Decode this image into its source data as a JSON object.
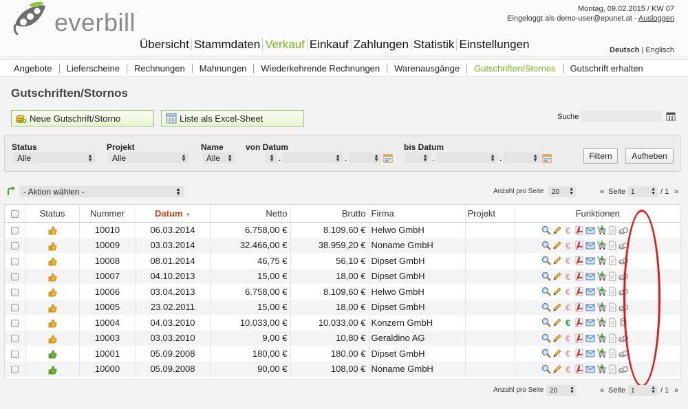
{
  "app": {
    "name": "everbill"
  },
  "user": {
    "date_line": "Montag, 09.02.2015 / KW 07",
    "login_line": "Eingeloggt als demo-user@epunet.at -",
    "logout": "Ausloggen"
  },
  "main_nav": [
    {
      "label": "Übersicht",
      "active": false
    },
    {
      "label": "Stammdaten",
      "active": false
    },
    {
      "label": "Verkauf",
      "active": true
    },
    {
      "label": "Einkauf",
      "active": false
    },
    {
      "label": "Zahlungen",
      "active": false
    },
    {
      "label": "Statistik",
      "active": false
    },
    {
      "label": "Einstellungen",
      "active": false
    }
  ],
  "lang": {
    "active": "Deutsch",
    "sep": "|",
    "other": "Englisch"
  },
  "sub_nav": [
    {
      "label": "Angebote",
      "active": false
    },
    {
      "label": "Lieferscheine",
      "active": false
    },
    {
      "label": "Rechnungen",
      "active": false
    },
    {
      "label": "Mahnungen",
      "active": false
    },
    {
      "label": "Wiederkehrende Rechnungen",
      "active": false
    },
    {
      "label": "Warenausgänge",
      "active": false
    },
    {
      "label": "Gutschriften/Stornos",
      "active": true
    },
    {
      "label": "Gutschrift erhalten",
      "active": false
    }
  ],
  "page_title": "Gutschriften/Stornos",
  "buttons": {
    "new": "Neue Gutschrift/Storno",
    "excel": "Liste als Excel-Sheet"
  },
  "search": {
    "label": "Suche",
    "value": ""
  },
  "filter": {
    "status_label": "Status",
    "status_value": "Alle",
    "projekt_label": "Projekt",
    "projekt_value": "Alle",
    "name_label": "Name",
    "name_value": "Alle",
    "from_label": "von Datum",
    "to_label": "bis Datum",
    "date_sep": ".",
    "filter_btn": "Filtern",
    "reset_btn": "Aufheben"
  },
  "actions": {
    "select_value": "- Aktion wählen -"
  },
  "pager": {
    "per_page_label": "Anzahl pro Seite",
    "per_page_value": "20",
    "prev": "«",
    "page_label": "Seite",
    "page_value": "1",
    "of": "/ 1",
    "next": "»"
  },
  "table": {
    "headers": {
      "status": "Status",
      "nummer": "Nummer",
      "datum": "Datum",
      "netto": "Netto",
      "brutto": "Brutto",
      "firma": "Firma",
      "projekt": "Projekt",
      "funktionen": "Funktionen"
    },
    "rows": [
      {
        "status": "yellow",
        "nummer": "10010",
        "datum": "06.03.2014",
        "netto": "6.758,00 €",
        "brutto": "8.109,60 €",
        "firma": "Helwo GmbH",
        "euro": "red",
        "last_icon": "coins-icon"
      },
      {
        "status": "yellow",
        "nummer": "10009",
        "datum": "03.03.2014",
        "netto": "32.466,00 €",
        "brutto": "38.959,20 €",
        "firma": "Noname GmbH",
        "euro": "red",
        "last_icon": "coins-icon"
      },
      {
        "status": "yellow",
        "nummer": "10008",
        "datum": "08.01.2014",
        "netto": "46,75 €",
        "brutto": "56,10 €",
        "firma": "Dipset GmbH",
        "euro": "red",
        "last_icon": "coins-icon"
      },
      {
        "status": "yellow",
        "nummer": "10007",
        "datum": "04.10.2013",
        "netto": "15,00 €",
        "brutto": "18,00 €",
        "firma": "Dipset GmbH",
        "euro": "red",
        "last_icon": "coins-icon"
      },
      {
        "status": "yellow",
        "nummer": "10006",
        "datum": "03.04.2013",
        "netto": "6.758,00 €",
        "brutto": "8.109,60 €",
        "firma": "Helwo GmbH",
        "euro": "red",
        "last_icon": "coins-icon"
      },
      {
        "status": "yellow",
        "nummer": "10005",
        "datum": "23.02.2011",
        "netto": "15,00 €",
        "brutto": "18,00 €",
        "firma": "Dipset GmbH",
        "euro": "red",
        "last_icon": "coins-icon"
      },
      {
        "status": "yellow",
        "nummer": "10004",
        "datum": "04.03.2010",
        "netto": "10.033,00 €",
        "brutto": "10.033,00 €",
        "firma": "Konzern GmbH",
        "euro": "green",
        "last_icon": "coin-stack-icon"
      },
      {
        "status": "yellow",
        "nummer": "10003",
        "datum": "03.03.2010",
        "netto": "9,00 €",
        "brutto": "10,80 €",
        "firma": "Geraldino AG",
        "euro": "red",
        "last_icon": "coins-icon"
      },
      {
        "status": "green",
        "nummer": "10001",
        "datum": "05.09.2008",
        "netto": "180,00 €",
        "brutto": "180,00 €",
        "firma": "Dipset GmbH",
        "euro": "red",
        "last_icon": "coins-icon"
      },
      {
        "status": "green",
        "nummer": "10000",
        "datum": "05.09.2008",
        "netto": "90,00 €",
        "brutto": "108,00 €",
        "firma": "Noname GmbH",
        "euro": "red",
        "last_icon": "coins-icon"
      }
    ]
  },
  "colors": {
    "accent_green": "#7bb31f",
    "sort_header": "#c0471b",
    "annotation_red": "#e41616"
  }
}
